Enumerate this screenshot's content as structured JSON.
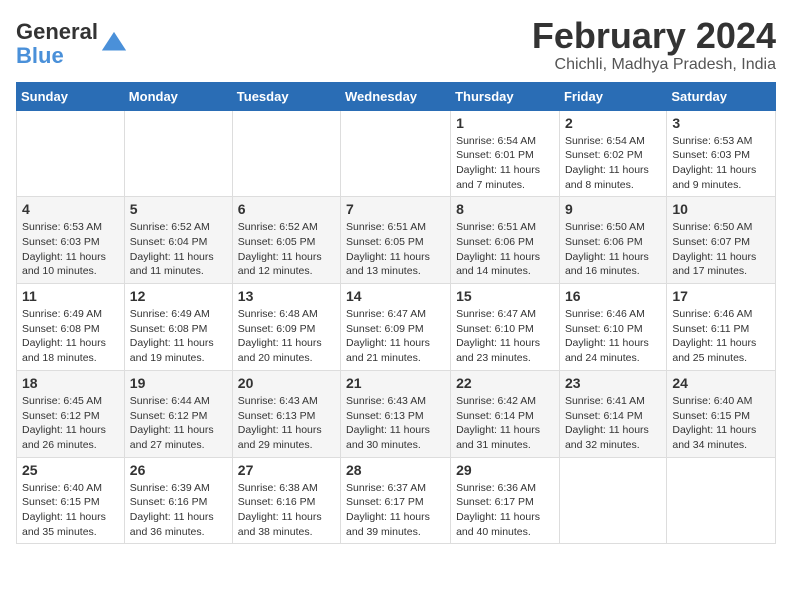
{
  "logo": {
    "line1": "General",
    "line2": "Blue"
  },
  "title": "February 2024",
  "location": "Chichli, Madhya Pradesh, India",
  "days_of_week": [
    "Sunday",
    "Monday",
    "Tuesday",
    "Wednesday",
    "Thursday",
    "Friday",
    "Saturday"
  ],
  "weeks": [
    [
      {
        "day": "",
        "info": ""
      },
      {
        "day": "",
        "info": ""
      },
      {
        "day": "",
        "info": ""
      },
      {
        "day": "",
        "info": ""
      },
      {
        "day": "1",
        "info": "Sunrise: 6:54 AM\nSunset: 6:01 PM\nDaylight: 11 hours\nand 7 minutes."
      },
      {
        "day": "2",
        "info": "Sunrise: 6:54 AM\nSunset: 6:02 PM\nDaylight: 11 hours\nand 8 minutes."
      },
      {
        "day": "3",
        "info": "Sunrise: 6:53 AM\nSunset: 6:03 PM\nDaylight: 11 hours\nand 9 minutes."
      }
    ],
    [
      {
        "day": "4",
        "info": "Sunrise: 6:53 AM\nSunset: 6:03 PM\nDaylight: 11 hours\nand 10 minutes."
      },
      {
        "day": "5",
        "info": "Sunrise: 6:52 AM\nSunset: 6:04 PM\nDaylight: 11 hours\nand 11 minutes."
      },
      {
        "day": "6",
        "info": "Sunrise: 6:52 AM\nSunset: 6:05 PM\nDaylight: 11 hours\nand 12 minutes."
      },
      {
        "day": "7",
        "info": "Sunrise: 6:51 AM\nSunset: 6:05 PM\nDaylight: 11 hours\nand 13 minutes."
      },
      {
        "day": "8",
        "info": "Sunrise: 6:51 AM\nSunset: 6:06 PM\nDaylight: 11 hours\nand 14 minutes."
      },
      {
        "day": "9",
        "info": "Sunrise: 6:50 AM\nSunset: 6:06 PM\nDaylight: 11 hours\nand 16 minutes."
      },
      {
        "day": "10",
        "info": "Sunrise: 6:50 AM\nSunset: 6:07 PM\nDaylight: 11 hours\nand 17 minutes."
      }
    ],
    [
      {
        "day": "11",
        "info": "Sunrise: 6:49 AM\nSunset: 6:08 PM\nDaylight: 11 hours\nand 18 minutes."
      },
      {
        "day": "12",
        "info": "Sunrise: 6:49 AM\nSunset: 6:08 PM\nDaylight: 11 hours\nand 19 minutes."
      },
      {
        "day": "13",
        "info": "Sunrise: 6:48 AM\nSunset: 6:09 PM\nDaylight: 11 hours\nand 20 minutes."
      },
      {
        "day": "14",
        "info": "Sunrise: 6:47 AM\nSunset: 6:09 PM\nDaylight: 11 hours\nand 21 minutes."
      },
      {
        "day": "15",
        "info": "Sunrise: 6:47 AM\nSunset: 6:10 PM\nDaylight: 11 hours\nand 23 minutes."
      },
      {
        "day": "16",
        "info": "Sunrise: 6:46 AM\nSunset: 6:10 PM\nDaylight: 11 hours\nand 24 minutes."
      },
      {
        "day": "17",
        "info": "Sunrise: 6:46 AM\nSunset: 6:11 PM\nDaylight: 11 hours\nand 25 minutes."
      }
    ],
    [
      {
        "day": "18",
        "info": "Sunrise: 6:45 AM\nSunset: 6:12 PM\nDaylight: 11 hours\nand 26 minutes."
      },
      {
        "day": "19",
        "info": "Sunrise: 6:44 AM\nSunset: 6:12 PM\nDaylight: 11 hours\nand 27 minutes."
      },
      {
        "day": "20",
        "info": "Sunrise: 6:43 AM\nSunset: 6:13 PM\nDaylight: 11 hours\nand 29 minutes."
      },
      {
        "day": "21",
        "info": "Sunrise: 6:43 AM\nSunset: 6:13 PM\nDaylight: 11 hours\nand 30 minutes."
      },
      {
        "day": "22",
        "info": "Sunrise: 6:42 AM\nSunset: 6:14 PM\nDaylight: 11 hours\nand 31 minutes."
      },
      {
        "day": "23",
        "info": "Sunrise: 6:41 AM\nSunset: 6:14 PM\nDaylight: 11 hours\nand 32 minutes."
      },
      {
        "day": "24",
        "info": "Sunrise: 6:40 AM\nSunset: 6:15 PM\nDaylight: 11 hours\nand 34 minutes."
      }
    ],
    [
      {
        "day": "25",
        "info": "Sunrise: 6:40 AM\nSunset: 6:15 PM\nDaylight: 11 hours\nand 35 minutes."
      },
      {
        "day": "26",
        "info": "Sunrise: 6:39 AM\nSunset: 6:16 PM\nDaylight: 11 hours\nand 36 minutes."
      },
      {
        "day": "27",
        "info": "Sunrise: 6:38 AM\nSunset: 6:16 PM\nDaylight: 11 hours\nand 38 minutes."
      },
      {
        "day": "28",
        "info": "Sunrise: 6:37 AM\nSunset: 6:17 PM\nDaylight: 11 hours\nand 39 minutes."
      },
      {
        "day": "29",
        "info": "Sunrise: 6:36 AM\nSunset: 6:17 PM\nDaylight: 11 hours\nand 40 minutes."
      },
      {
        "day": "",
        "info": ""
      },
      {
        "day": "",
        "info": ""
      }
    ]
  ]
}
